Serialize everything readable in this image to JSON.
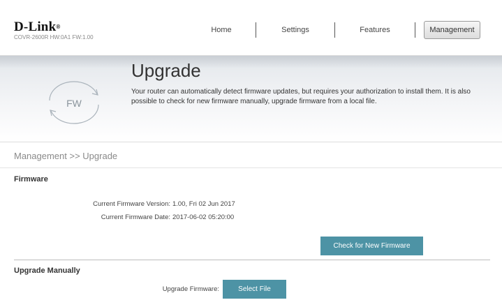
{
  "header": {
    "brand": "D-Link",
    "brand_mark": "®",
    "model_info": "COVR-2600R HW:0A1 FW:1.00"
  },
  "nav": {
    "home": "Home",
    "settings": "Settings",
    "features": "Features",
    "management": "Management",
    "active": "Management"
  },
  "banner": {
    "icon_label": "FW",
    "title": "Upgrade",
    "description": "Your router can automatically detect firmware updates, but requires your authorization to install them. It is also possible to check for new firmware manually, upgrade firmware from a local file."
  },
  "breadcrumb": "Management >> Upgrade",
  "firmware": {
    "section_title": "Firmware",
    "version_label": "Current Firmware Version:",
    "version_value": "1.00, Fri 02 Jun 2017",
    "date_label": "Current Firmware Date:",
    "date_value": "2017-06-02 05:20:00",
    "check_button": "Check for New Firmware"
  },
  "manual": {
    "section_title": "Upgrade Manually",
    "upgrade_label": "Upgrade Firmware:",
    "select_button": "Select File"
  },
  "colors": {
    "accent_button": "#4d93a5",
    "banner_top": "#e3e7eb"
  }
}
